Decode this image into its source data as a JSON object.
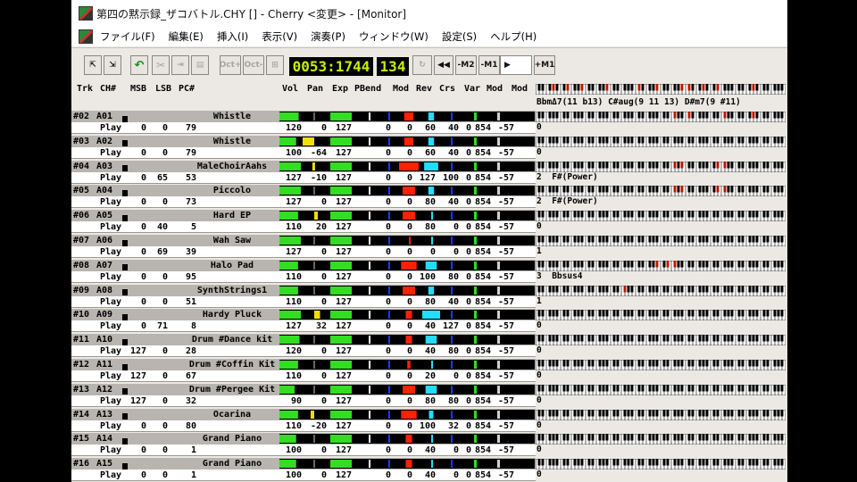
{
  "window": {
    "title": "第四の黙示録_ザコバトル.CHY [] - Cherry <変更> - [Monitor]"
  },
  "menu": [
    "ファイル(F)",
    "編集(E)",
    "挿入(I)",
    "表示(V)",
    "演奏(P)",
    "ウィンドウ(W)",
    "設定(S)",
    "ヘルプ(H)"
  ],
  "toolbar": {
    "oct_up": "Oct+",
    "oct_down": "Oct-",
    "position": "0053:1744",
    "tempo": "134",
    "rew_label": "◀◀",
    "m2_label": "-M2",
    "m1_label": "-M1",
    "play_label": "▶",
    "p1_label": "+M1"
  },
  "header": {
    "trk": "Trk",
    "ch": "CH#",
    "msb": "MSB",
    "lsb": "LSB",
    "pc": "PC#",
    "vol": "Vol",
    "pan": "Pan",
    "exp": "Exp",
    "pbend": "PBend",
    "mod": "Mod",
    "rev": "Rev",
    "crs": "Crs",
    "var": "Var",
    "mod2": "Mod",
    "mod3": "Mod",
    "chord": "BbmΔ7(11 b13) C#aug(9 11 13) D#m7(9 #11)"
  },
  "colors": {
    "green": "#33dd22",
    "yellow": "#f0e000",
    "red": "#ff2200",
    "cyan": "#22ddff",
    "lcd": "#c8f000"
  },
  "tracks": [
    {
      "trk": "#02",
      "ch": "A01",
      "name": "Whistle",
      "state": "Play",
      "msb": "0",
      "lsb": "0",
      "pc": "79",
      "vol": "120",
      "pan": "0",
      "exp": "127",
      "pb": "0",
      "mod": "0",
      "rev": "60",
      "crs": "40",
      "var": "0",
      "m1": "854",
      "m2": "-57",
      "note": "0",
      "chord": "",
      "panbar": "",
      "marks": [
        38,
        42,
        52,
        55,
        60
      ],
      "bars": {
        "vol": 0.9,
        "pan": 0,
        "exp": 1,
        "mod": 0,
        "rev": 0.47,
        "crs": 0.32
      }
    },
    {
      "trk": "#03",
      "ch": "A02",
      "name": "Whistle",
      "state": "Play",
      "msb": "0",
      "lsb": "0",
      "pc": "79",
      "vol": "100",
      "pan": "-64",
      "exp": "127",
      "pb": "0",
      "mod": "0",
      "rev": "60",
      "crs": "40",
      "var": "0",
      "m1": "854",
      "m2": "-57",
      "note": "0",
      "chord": "",
      "marks": [],
      "bars": {
        "vol": 0.78,
        "pan": -1,
        "exp": 1,
        "mod": 0,
        "rev": 0.47,
        "crs": 0.32
      }
    },
    {
      "trk": "#04",
      "ch": "A03",
      "name": "MaleChoirAahs",
      "state": "Play",
      "msb": "0",
      "lsb": "65",
      "pc": "53",
      "vol": "127",
      "pan": "-10",
      "exp": "127",
      "pb": "0",
      "mod": "0",
      "rev": "127",
      "crs": "100",
      "var": "0",
      "m1": "854",
      "m2": "-57",
      "note": "2",
      "chord": "F#(Power)",
      "marks": [
        38,
        40,
        50,
        52
      ],
      "bars": {
        "vol": 1,
        "pan": -0.16,
        "exp": 1,
        "mod": 0,
        "rev": 1,
        "crs": 0.79
      }
    },
    {
      "trk": "#05",
      "ch": "A04",
      "name": "Piccolo",
      "state": "Play",
      "msb": "0",
      "lsb": "0",
      "pc": "73",
      "vol": "127",
      "pan": "0",
      "exp": "127",
      "pb": "0",
      "mod": "0",
      "rev": "80",
      "crs": "40",
      "var": "0",
      "m1": "854",
      "m2": "-57",
      "note": "2",
      "chord": "F#(Power)",
      "marks": [
        38,
        40,
        50,
        52
      ],
      "bars": {
        "vol": 1,
        "pan": 0,
        "exp": 1,
        "mod": 0,
        "rev": 0.63,
        "crs": 0.32
      }
    },
    {
      "trk": "#06",
      "ch": "A05",
      "name": "Hard EP",
      "state": "Play",
      "msb": "0",
      "lsb": "40",
      "pc": "5",
      "vol": "110",
      "pan": "20",
      "exp": "127",
      "pb": "0",
      "mod": "0",
      "rev": "80",
      "crs": "0",
      "var": "0",
      "m1": "854",
      "m2": "-57",
      "note": "0",
      "chord": "",
      "marks": [],
      "bars": {
        "vol": 0.87,
        "pan": 0.31,
        "exp": 1,
        "mod": 0,
        "rev": 0.63,
        "crs": 0
      }
    },
    {
      "trk": "#07",
      "ch": "A06",
      "name": "Wah Saw",
      "state": "Play",
      "msb": "0",
      "lsb": "69",
      "pc": "39",
      "vol": "127",
      "pan": "0",
      "exp": "127",
      "pb": "0",
      "mod": "0",
      "rev": "0",
      "crs": "0",
      "var": "0",
      "m1": "854",
      "m2": "-57",
      "note": "1",
      "chord": "",
      "marks": [
        16
      ],
      "bars": {
        "vol": 1,
        "pan": 0,
        "exp": 1,
        "mod": 0,
        "rev": 0,
        "crs": 0
      }
    },
    {
      "trk": "#08",
      "ch": "A07",
      "name": "Halo Pad",
      "state": "Play",
      "msb": "0",
      "lsb": "0",
      "pc": "95",
      "vol": "110",
      "pan": "0",
      "exp": "127",
      "pb": "0",
      "mod": "0",
      "rev": "100",
      "crs": "80",
      "var": "0",
      "m1": "854",
      "m2": "-57",
      "note": "3",
      "chord": "Bbsus4",
      "marks": [
        33,
        36,
        38
      ],
      "bars": {
        "vol": 0.87,
        "pan": 0,
        "exp": 1,
        "mod": 0,
        "rev": 0.79,
        "crs": 0.63
      }
    },
    {
      "trk": "#09",
      "ch": "A08",
      "name": "SynthStrings1",
      "state": "Play",
      "msb": "0",
      "lsb": "0",
      "pc": "51",
      "vol": "110",
      "pan": "0",
      "exp": "127",
      "pb": "0",
      "mod": "0",
      "rev": "80",
      "crs": "40",
      "var": "0",
      "m1": "854",
      "m2": "-57",
      "note": "1",
      "chord": "",
      "marks": [
        24
      ],
      "bars": {
        "vol": 0.87,
        "pan": 0,
        "exp": 1,
        "mod": 0,
        "rev": 0.63,
        "crs": 0.32
      }
    },
    {
      "trk": "#10",
      "ch": "A09",
      "name": "Hardy Pluck",
      "state": "Play",
      "msb": "0",
      "lsb": "71",
      "pc": "8",
      "vol": "127",
      "pan": "32",
      "exp": "127",
      "pb": "0",
      "mod": "0",
      "rev": "40",
      "crs": "127",
      "var": "0",
      "m1": "854",
      "m2": "-57",
      "note": "0",
      "chord": "",
      "marks": [],
      "bars": {
        "vol": 1,
        "pan": 0.5,
        "exp": 1,
        "mod": 0,
        "rev": 0.32,
        "crs": 1
      }
    },
    {
      "trk": "#11",
      "ch": "A10",
      "name": "Drum   #Dance kit",
      "state": "Play",
      "msb": "127",
      "lsb": "0",
      "pc": "28",
      "vol": "120",
      "pan": "0",
      "exp": "127",
      "pb": "0",
      "mod": "0",
      "rev": "40",
      "crs": "80",
      "var": "0",
      "m1": "854",
      "m2": "-57",
      "note": "0",
      "chord": "",
      "marks": [],
      "bars": {
        "vol": 0.94,
        "pan": 0,
        "exp": 1,
        "mod": 0,
        "rev": 0.32,
        "crs": 0.63
      }
    },
    {
      "trk": "#12",
      "ch": "A11",
      "name": "Drum   #Coffin Kit",
      "state": "Play",
      "msb": "127",
      "lsb": "0",
      "pc": "67",
      "vol": "110",
      "pan": "0",
      "exp": "127",
      "pb": "0",
      "mod": "0",
      "rev": "20",
      "crs": "0",
      "var": "0",
      "m1": "854",
      "m2": "-57",
      "note": "0",
      "chord": "",
      "marks": [],
      "bars": {
        "vol": 0.87,
        "pan": 0,
        "exp": 1,
        "mod": 0,
        "rev": 0.16,
        "crs": 0
      }
    },
    {
      "trk": "#13",
      "ch": "A12",
      "name": "Drum   #Pergee Kit",
      "state": "Play",
      "msb": "127",
      "lsb": "0",
      "pc": "32",
      "vol": "90",
      "pan": "0",
      "exp": "127",
      "pb": "0",
      "mod": "0",
      "rev": "80",
      "crs": "80",
      "var": "0",
      "m1": "854",
      "m2": "-57",
      "note": "0",
      "chord": "",
      "marks": [],
      "bars": {
        "vol": 0.71,
        "pan": 0,
        "exp": 1,
        "mod": 0,
        "rev": 0.63,
        "crs": 0.63
      }
    },
    {
      "trk": "#14",
      "ch": "A13",
      "name": "Ocarina",
      "state": "Play",
      "msb": "0",
      "lsb": "0",
      "pc": "80",
      "vol": "110",
      "pan": "-20",
      "exp": "127",
      "pb": "0",
      "mod": "0",
      "rev": "100",
      "crs": "32",
      "var": "0",
      "m1": "854",
      "m2": "-57",
      "note": "0",
      "chord": "",
      "marks": [],
      "bars": {
        "vol": 0.87,
        "pan": -0.31,
        "exp": 1,
        "mod": 0,
        "rev": 0.79,
        "crs": 0.25
      }
    },
    {
      "trk": "#15",
      "ch": "A14",
      "name": "Grand Piano",
      "state": "Play",
      "msb": "0",
      "lsb": "0",
      "pc": "1",
      "vol": "100",
      "pan": "0",
      "exp": "127",
      "pb": "0",
      "mod": "0",
      "rev": "40",
      "crs": "0",
      "var": "0",
      "m1": "854",
      "m2": "-57",
      "note": "0",
      "chord": "",
      "marks": [],
      "bars": {
        "vol": 0.78,
        "pan": 0,
        "exp": 1,
        "mod": 0,
        "rev": 0.32,
        "crs": 0
      }
    },
    {
      "trk": "#16",
      "ch": "A15",
      "name": "Grand Piano",
      "state": "Play",
      "msb": "0",
      "lsb": "0",
      "pc": "1",
      "vol": "100",
      "pan": "0",
      "exp": "127",
      "pb": "0",
      "mod": "0",
      "rev": "40",
      "crs": "0",
      "var": "0",
      "m1": "854",
      "m2": "-57",
      "note": "0",
      "chord": "",
      "marks": [],
      "bars": {
        "vol": 0.78,
        "pan": 0,
        "exp": 1,
        "mod": 0,
        "rev": 0.32,
        "crs": 0
      }
    }
  ]
}
